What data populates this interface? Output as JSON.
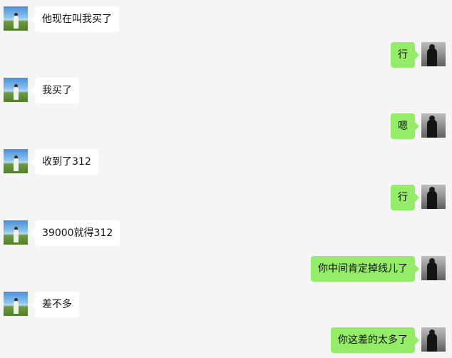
{
  "colors": {
    "background": "#f5f5f5",
    "incoming_bubble": "#ffffff",
    "outgoing_bubble": "#95ec69",
    "text": "#111111"
  },
  "messages": [
    {
      "side": "incoming",
      "avatar": "landscape-avatar",
      "text": "他现在叫我买了"
    },
    {
      "side": "outgoing",
      "avatar": "dark-portrait-avatar",
      "text": "行"
    },
    {
      "side": "incoming",
      "avatar": "landscape-avatar",
      "text": "我买了"
    },
    {
      "side": "outgoing",
      "avatar": "dark-portrait-avatar",
      "text": "嗯"
    },
    {
      "side": "incoming",
      "avatar": "landscape-avatar",
      "text": "收到了312"
    },
    {
      "side": "outgoing",
      "avatar": "dark-portrait-avatar",
      "text": "行"
    },
    {
      "side": "incoming",
      "avatar": "landscape-avatar",
      "text": "39000就得312"
    },
    {
      "side": "outgoing",
      "avatar": "dark-portrait-avatar",
      "text": "你中间肯定掉线儿了"
    },
    {
      "side": "incoming",
      "avatar": "landscape-avatar",
      "text": "差不多"
    },
    {
      "side": "outgoing",
      "avatar": "dark-portrait-avatar",
      "text": "你这差的太多了"
    }
  ]
}
